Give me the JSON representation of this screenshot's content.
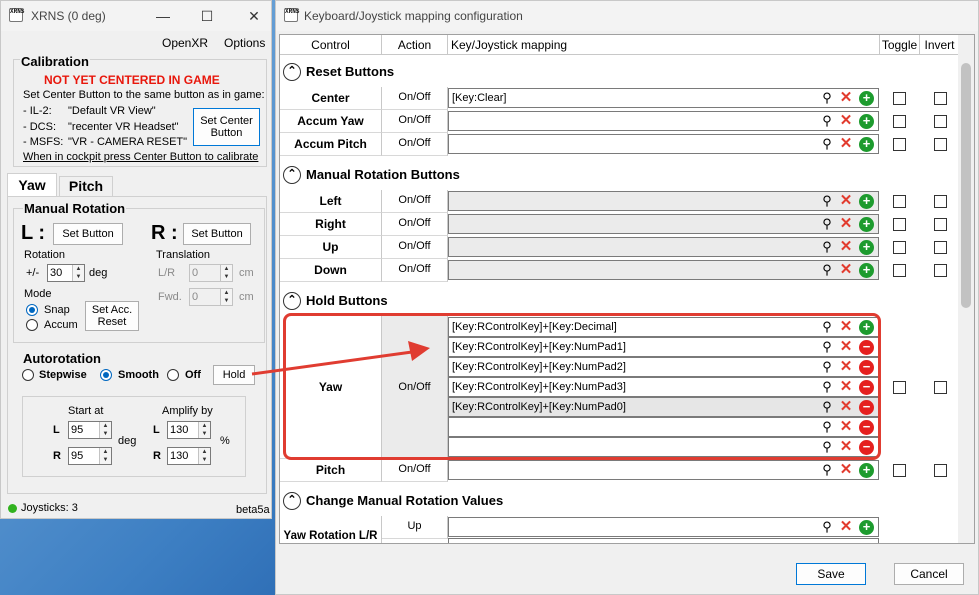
{
  "left_window": {
    "title": "XRNS (0 deg)",
    "logo_text": "XRNS",
    "caption_buttons": {
      "minimize": "—",
      "maximize": "☐",
      "close": "✕"
    },
    "menu": [
      "OpenXR",
      "Options"
    ],
    "calibration": {
      "title": "Calibration",
      "status": "NOT YET CENTERED IN GAME",
      "instruction": "Set Center Button to the same button as in game:",
      "sims": [
        {
          "name": "-  IL-2:",
          "value": "\"Default VR View\""
        },
        {
          "name": "-  DCS:",
          "value": "\"recenter VR Headset\""
        },
        {
          "name": "-  MSFS:",
          "value": "\"VR - CAMERA RESET\""
        }
      ],
      "set_center_button": "Set Center Button",
      "footer": "When in cockpit press Center Button to calibrate"
    },
    "tabs": [
      "Yaw",
      "Pitch"
    ],
    "manual_rotation": {
      "title": "Manual Rotation",
      "l_label": "L :",
      "r_label": "R :",
      "set_button": "Set Button",
      "rotation_label": "Rotation",
      "rotation_prefix": "+/-",
      "rotation_value": "30",
      "rotation_unit": "deg",
      "translation_label": "Translation",
      "lr_label": "L/R",
      "lr_value": "0",
      "lr_unit": "cm",
      "fwd_label": "Fwd.",
      "fwd_value": "0",
      "fwd_unit": "cm",
      "mode_label": "Mode",
      "snap_label": "Snap",
      "accum_label": "Accum",
      "set_acc_reset": "Set Acc. Reset"
    },
    "autorotation": {
      "title": "Autorotation",
      "stepwise": "Stepwise",
      "smooth": "Smooth",
      "off": "Off",
      "hold_button": "Hold",
      "start_at_label": "Start at",
      "amplify_by_label": "Amplify by",
      "l": "L",
      "r": "R",
      "start_l": "95",
      "start_r": "95",
      "deg_unit": "deg",
      "amp_l": "130",
      "amp_r": "130",
      "percent_unit": "%"
    },
    "status_bar": {
      "joysticks": "Joysticks: 3",
      "version": "beta5a"
    }
  },
  "right_window": {
    "title": "Keyboard/Joystick mapping configuration",
    "logo_text": "XRNS",
    "columns": [
      "Control",
      "Action",
      "Key/Joystick mapping",
      "Toggle",
      "Invert"
    ],
    "sections": {
      "reset": "Reset Buttons",
      "manual": "Manual Rotation Buttons",
      "hold": "Hold Buttons",
      "change": "Change Manual Rotation Values"
    },
    "collapse_glyph": "⌃",
    "rows": {
      "center": {
        "control": "Center",
        "action": "On/Off",
        "mapping": "[Key:Clear]"
      },
      "accum_yaw": {
        "control": "Accum Yaw",
        "action": "On/Off",
        "mapping": ""
      },
      "accum_pitch": {
        "control": "Accum Pitch",
        "action": "On/Off",
        "mapping": ""
      },
      "left": {
        "control": "Left",
        "action": "On/Off",
        "mapping": ""
      },
      "right": {
        "control": "Right",
        "action": "On/Off",
        "mapping": ""
      },
      "up": {
        "control": "Up",
        "action": "On/Off",
        "mapping": ""
      },
      "down": {
        "control": "Down",
        "action": "On/Off",
        "mapping": ""
      },
      "yaw": {
        "control": "Yaw",
        "action": "On/Off",
        "mappings": [
          "[Key:RControlKey]+[Key:Decimal]",
          "[Key:RControlKey]+[Key:NumPad1]",
          "[Key:RControlKey]+[Key:NumPad2]",
          "[Key:RControlKey]+[Key:NumPad3]",
          "[Key:RControlKey]+[Key:NumPad0]",
          "",
          ""
        ]
      },
      "pitch": {
        "control": "Pitch",
        "action": "On/Off",
        "mapping": ""
      },
      "yaw_rotation": {
        "control": "Yaw Rotation L/R",
        "action": "Up",
        "mapping": ""
      }
    },
    "icons": {
      "search": "⚲",
      "delete": "✕",
      "add": "+",
      "remove": "−"
    },
    "buttons": {
      "save": "Save",
      "cancel": "Cancel"
    }
  },
  "colors": {
    "warning_red": "#e8170c",
    "annotation_red": "#e03c31",
    "add_green": "#1d9b2e",
    "remove_red": "#e5201f",
    "accent_blue": "#0067c0"
  }
}
